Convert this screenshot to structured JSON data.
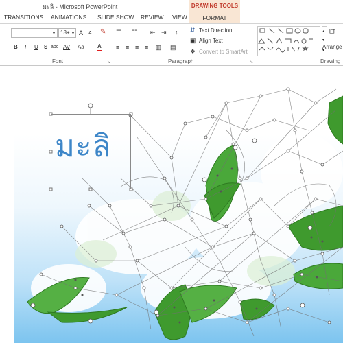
{
  "window": {
    "title": "มะลิ - Microsoft PowerPoint",
    "context_header": "DRAWING TOOLS"
  },
  "tabs": [
    "TRANSITIONS",
    "ANIMATIONS",
    "SLIDE SHOW",
    "REVIEW",
    "VIEW"
  ],
  "context_tab": "FORMAT",
  "ribbon": {
    "font": {
      "size_value": "18+",
      "grow_label": "A",
      "shrink_label": "A",
      "bold": "B",
      "italic": "I",
      "underline": "U",
      "shadow": "S",
      "strike": "abc",
      "spacing": "AV",
      "case": "Aa",
      "color_label": "A",
      "group_label": "Font"
    },
    "paragraph": {
      "text_direction": "Text Direction",
      "align_text": "Align Text",
      "convert_smartart": "Convert to SmartArt",
      "group_label": "Paragraph"
    },
    "drawing": {
      "arrange": "Arrange",
      "group_label": "Drawing"
    }
  },
  "slide": {
    "title_text": "มะลิ"
  },
  "colors": {
    "context_tab_bg": "#f9e6d4",
    "context_tab_text": "#c0392b",
    "title_text": "#3d86c8",
    "petal_green": "#3f9a2e"
  }
}
